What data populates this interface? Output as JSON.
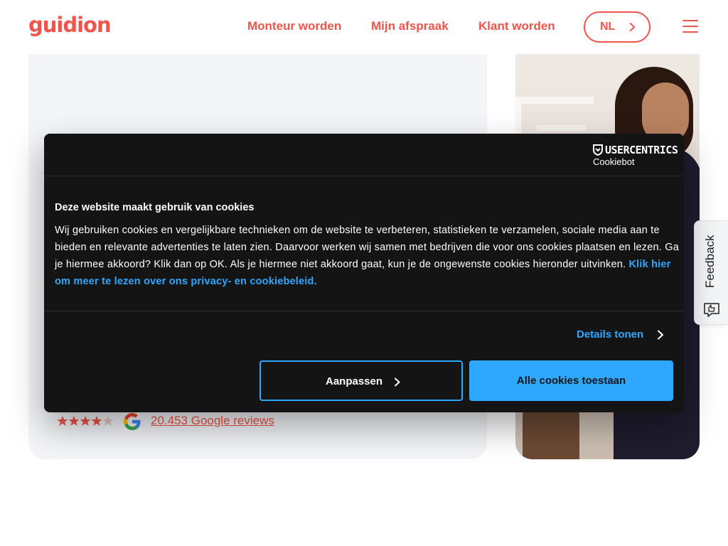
{
  "header": {
    "logo": "guidion",
    "nav": [
      "Monteur worden",
      "Mijn afspraak",
      "Klant worden"
    ],
    "language": "NL"
  },
  "hero": {
    "rating": 4.5,
    "reviews_text": "20.453 Google reviews"
  },
  "feedback": {
    "label": "Feedback"
  },
  "cookie": {
    "brand": "USERCENTRICS",
    "brand_sub": "Cookiebot",
    "title": "Deze website maakt gebruik van cookies",
    "body": "Wij gebruiken cookies en vergelijkbare technieken om de website te verbeteren, statistieken te verzamelen, sociale media aan te bieden en relevante advertenties te laten zien. Daarvoor werken wij samen met bedrijven die voor ons cookies plaatsen en lezen. Ga je hiermee akkoord? Klik dan op OK. Als je hiermee niet akkoord gaat, kun je de ongewenste cookies hieronder uitvinken.",
    "policy_link": "Klik hier om meer te lezen over ons privacy- en cookiebeleid.",
    "details_label": "Details tonen",
    "customize_label": "Aanpassen",
    "allow_all_label": "Alle cookies toestaan"
  },
  "colors": {
    "brand": "#f2544a",
    "accent": "#2ea8ff",
    "dialog": "#141414"
  }
}
